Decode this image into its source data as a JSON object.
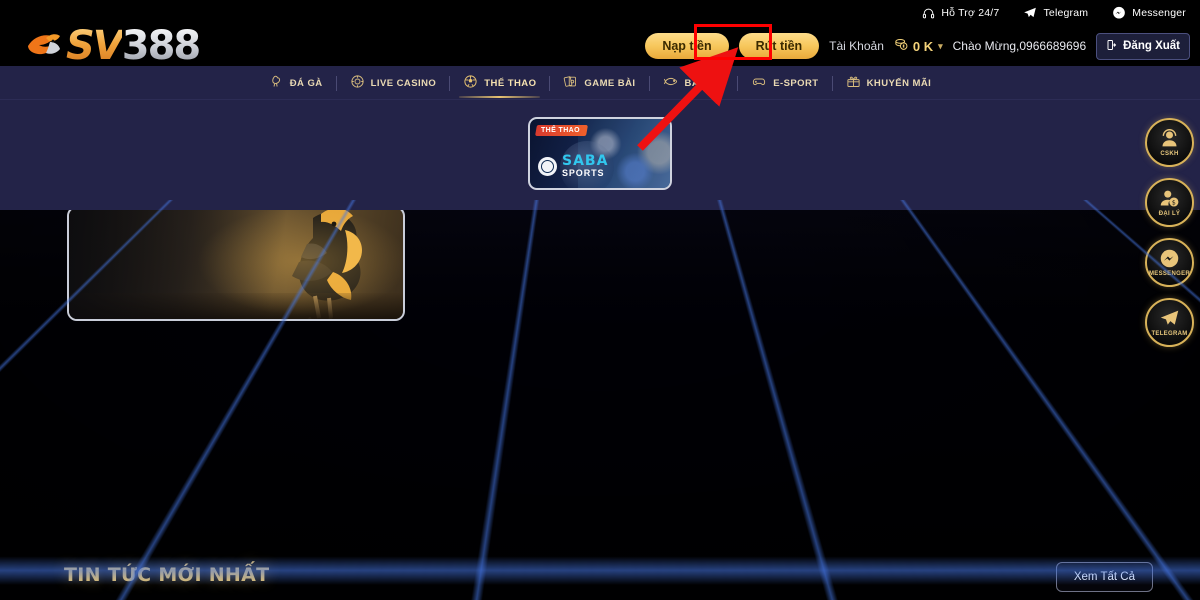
{
  "topbar": {
    "items": [
      {
        "label": "Hỗ Trợ 24/7",
        "icon": "headset-icon"
      },
      {
        "label": "Telegram",
        "icon": "telegram-icon"
      },
      {
        "label": "Messenger",
        "icon": "messenger-icon"
      }
    ]
  },
  "header": {
    "logo": {
      "part1": "SV",
      "part2": "388",
      "alt": "sv388-logo"
    },
    "deposit_label": "Nạp tiền",
    "withdraw_label": "Rút tiền",
    "account_label": "Tài Khoản",
    "balance": "0 K",
    "balance_chevron": "▾",
    "greeting": "Chào Mừng,0966689696",
    "logout_label": "Đăng Xuất"
  },
  "nav": {
    "items": [
      {
        "label": "ĐÁ GÀ",
        "icon": "rooster-icon",
        "active": false
      },
      {
        "label": "LIVE CASINO",
        "icon": "casino-chip-icon",
        "active": false
      },
      {
        "label": "THỂ THAO",
        "icon": "soccer-ball-icon",
        "active": true
      },
      {
        "label": "GAME BÀI",
        "icon": "playing-cards-icon",
        "active": false
      },
      {
        "label": "BẮN CÁ",
        "icon": "fish-icon",
        "active": false
      },
      {
        "label": "E-SPORT",
        "icon": "gamepad-icon",
        "active": false
      },
      {
        "label": "KHUYẾN MÃI",
        "icon": "gift-icon",
        "active": false
      }
    ]
  },
  "hero": {
    "saba_card": {
      "badge": "THỂ THAO",
      "brand_line1": "SABA",
      "brand_line2": "SPORTS"
    }
  },
  "promo": {
    "rooster_card": {
      "alt": "rooster-promo-banner"
    }
  },
  "side_rail": {
    "items": [
      {
        "label": "CSKH",
        "icon": "support-agent-icon"
      },
      {
        "label": "ĐẠI LÝ",
        "icon": "agent-money-icon"
      },
      {
        "label": "MESSENGER",
        "icon": "messenger-icon"
      },
      {
        "label": "TELEGRAM",
        "icon": "telegram-icon"
      }
    ]
  },
  "news": {
    "title": "TIN TỨC MỚI NHẤT",
    "view_all_label": "Xem Tất Cả"
  },
  "annotation": {
    "highlight_target": "Nạp tiền",
    "box_color": "#ff0000",
    "arrow_color": "#ee1111"
  },
  "colors": {
    "gold": "#e8c268",
    "navy": "#232348",
    "black": "#000000",
    "accent_red": "#ff0000",
    "saba_cyan": "#31c7ee"
  }
}
